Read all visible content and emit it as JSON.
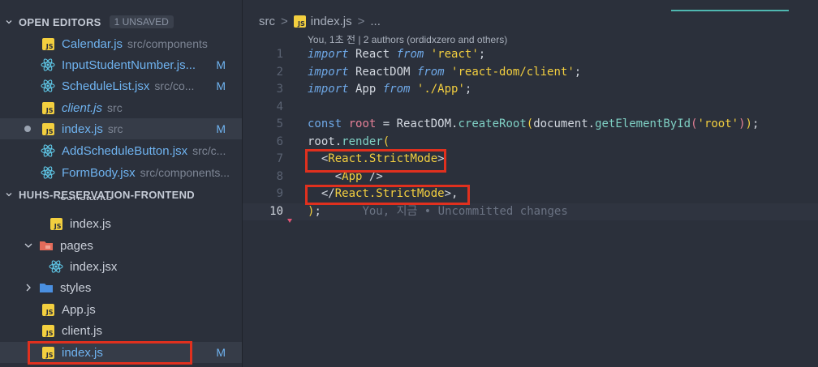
{
  "explorer": {
    "open_editors": {
      "title": "OPEN EDITORS",
      "badge": "1 UNSAVED"
    },
    "open_files": [
      {
        "name": "Calendar.js",
        "path": "src/components",
        "type": "js",
        "mod": ""
      },
      {
        "name": "InputStudentNumber.js...",
        "path": "",
        "type": "react",
        "mod": "M"
      },
      {
        "name": "ScheduleList.jsx",
        "path": "src/co...",
        "type": "react",
        "mod": "M"
      },
      {
        "name": "client.js",
        "path": "src",
        "type": "js",
        "mod": ""
      },
      {
        "name": "index.js",
        "path": "src",
        "type": "js",
        "mod": "M"
      },
      {
        "name": "AddScheduleButton.jsx",
        "path": "src/c...",
        "type": "react",
        "mod": ""
      },
      {
        "name": "FormBody.jsx",
        "path": "src/components...",
        "type": "react",
        "mod": ""
      }
    ],
    "project": {
      "title": "HUHS-RESERVATION-FRONTEND"
    },
    "tree": [
      {
        "name": "constants",
        "type": "folder"
      },
      {
        "name": "index.js",
        "type": "js"
      },
      {
        "name": "pages",
        "type": "folder"
      },
      {
        "name": "index.jsx",
        "type": "react"
      },
      {
        "name": "styles",
        "type": "folder"
      },
      {
        "name": "App.js",
        "type": "js"
      },
      {
        "name": "client.js",
        "type": "js"
      },
      {
        "name": "index.js",
        "type": "js",
        "mod": "M"
      }
    ]
  },
  "editor": {
    "breadcrumb": {
      "folder": "src",
      "file": "index.js",
      "more": "..."
    },
    "blame_header": "You, 1초 전 | 2 authors (ordidxzero and others)",
    "line_numbers": [
      "1",
      "2",
      "3",
      "4",
      "5",
      "6",
      "7",
      "8",
      "9",
      "10"
    ],
    "inline_blame": "You, 지금 • Uncommitted changes"
  },
  "colors": {
    "accent": "#6fb3f0",
    "highlight_box": "#e0301e",
    "js_icon": "#f3cf3f"
  }
}
